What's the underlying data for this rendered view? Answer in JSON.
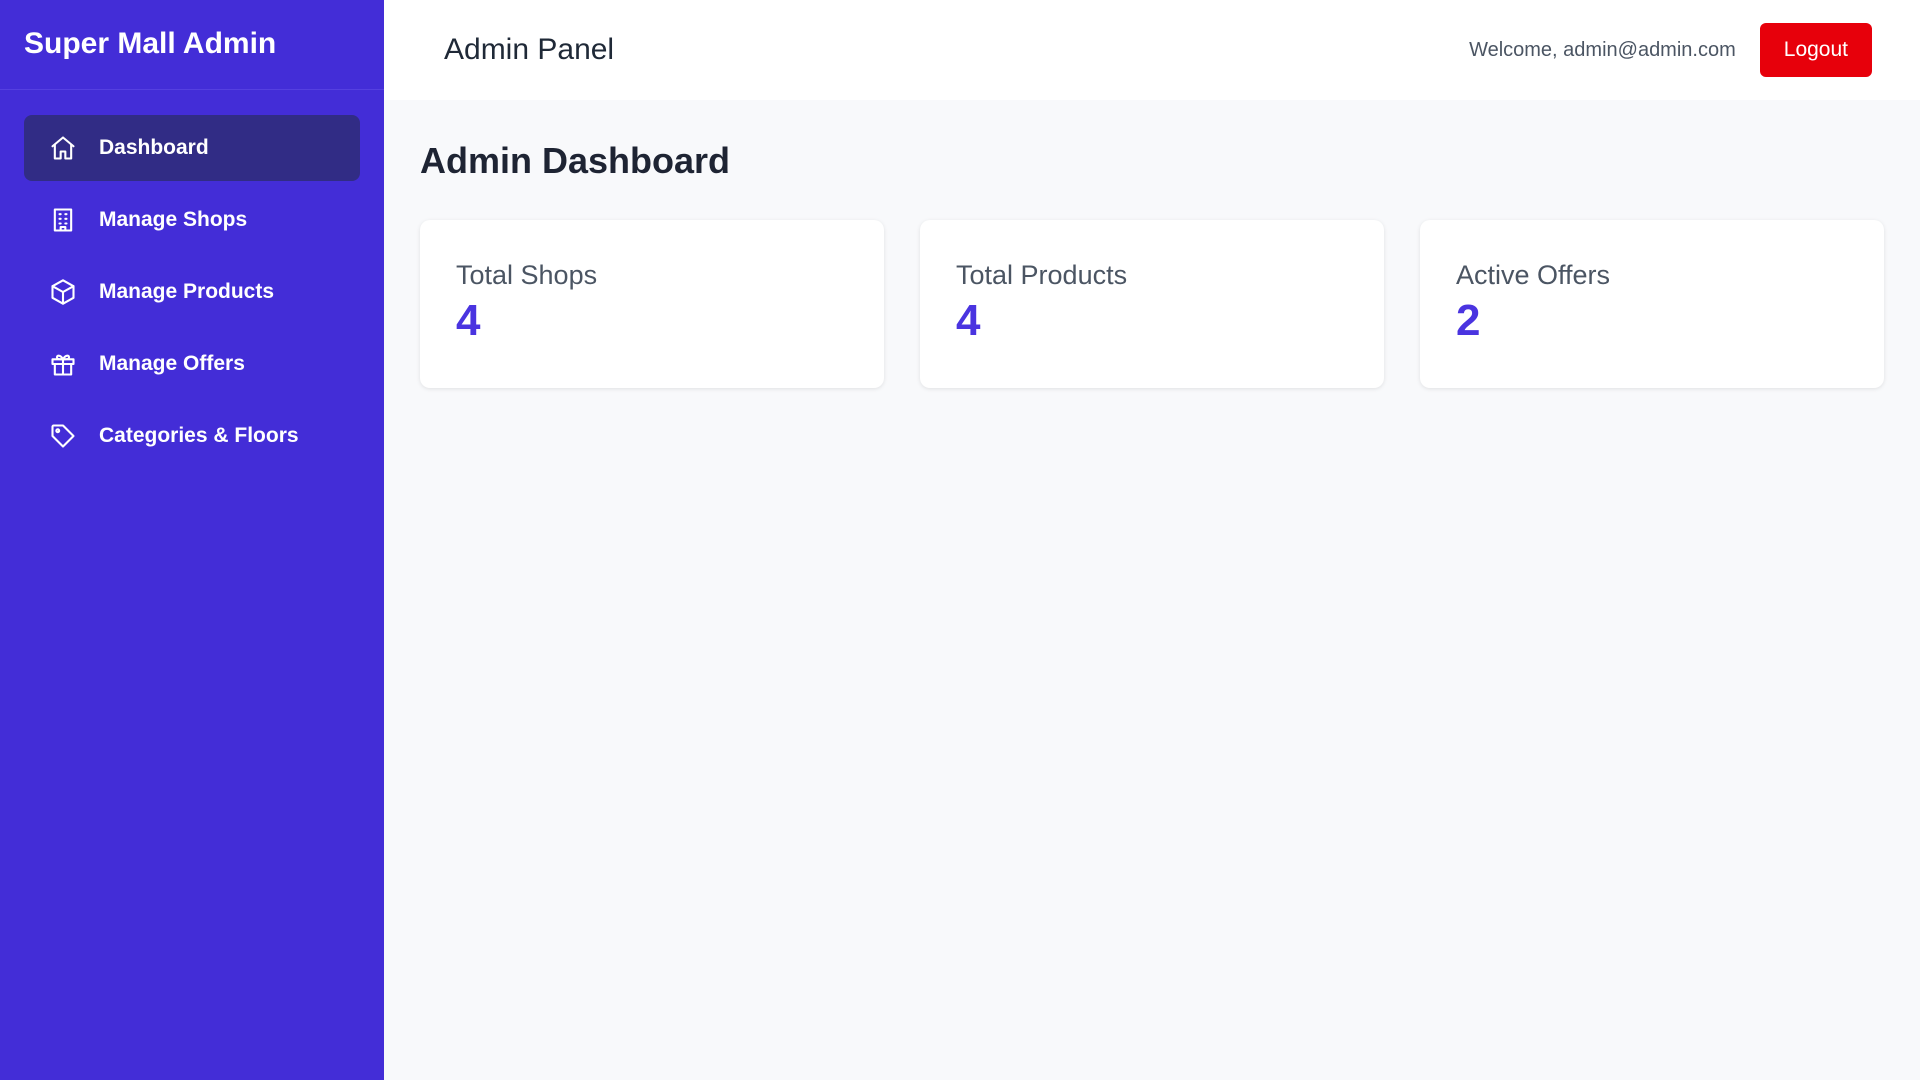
{
  "sidebar": {
    "brand": "Super Mall Admin",
    "items": [
      {
        "label": "Dashboard",
        "icon": "home-icon",
        "active": true
      },
      {
        "label": "Manage Shops",
        "icon": "building-icon"
      },
      {
        "label": "Manage Products",
        "icon": "box-icon"
      },
      {
        "label": "Manage Offers",
        "icon": "gift-icon"
      },
      {
        "label": "Categories & Floors",
        "icon": "tag-icon"
      }
    ]
  },
  "header": {
    "title": "Admin Panel",
    "welcome": "Welcome, admin@admin.com",
    "logout_label": "Logout"
  },
  "main": {
    "title": "Admin Dashboard",
    "stats": [
      {
        "label": "Total Shops",
        "value": "4"
      },
      {
        "label": "Total Products",
        "value": "4"
      },
      {
        "label": "Active Offers",
        "value": "2"
      }
    ]
  },
  "colors": {
    "sidebar_bg": "#432dd7",
    "active_item_bg": "#312c85",
    "accent": "#4a34e0",
    "logout_bg": "#e7000b"
  }
}
